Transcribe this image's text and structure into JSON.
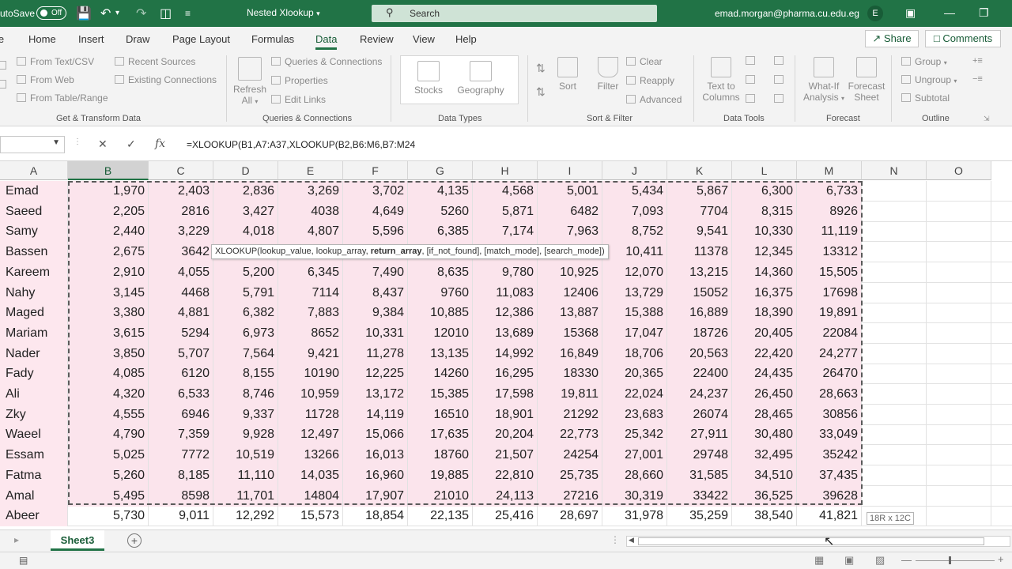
{
  "titlebar": {
    "autosave_label": "utoSave",
    "toggle_state": "Off",
    "doc_title": "Nested Xlookup",
    "search_placeholder": "Search",
    "account": "emad.morgan@pharma.cu.edu.eg",
    "avatar_initial": "E"
  },
  "tabs": [
    "le",
    "Home",
    "Insert",
    "Draw",
    "Page Layout",
    "Formulas",
    "Data",
    "Review",
    "View",
    "Help"
  ],
  "share_label": "Share",
  "comments_label": "Comments",
  "ribbon": {
    "get_transform": {
      "items": [
        "From Text/CSV",
        "From Web",
        "From Table/Range",
        "Recent Sources",
        "Existing Connections"
      ],
      "label": "Get & Transform Data"
    },
    "queries": {
      "refresh": "Refresh",
      "refresh_all": "All",
      "items": [
        "Queries & Connections",
        "Properties",
        "Edit Links"
      ],
      "label": "Queries & Connections"
    },
    "data_types": {
      "items": [
        "Stocks",
        "Geography"
      ],
      "label": "Data Types"
    },
    "sort_filter": {
      "sort": "Sort",
      "filter": "Filter",
      "items": [
        "Clear",
        "Reapply",
        "Advanced"
      ],
      "label": "Sort & Filter"
    },
    "data_tools": {
      "text_to": "Text to",
      "columns": "Columns",
      "label": "Data Tools"
    },
    "forecast": {
      "whatif": "What-If",
      "analysis": "Analysis",
      "forecast_line1": "Forecast",
      "forecast_line2": "Sheet",
      "label": "Forecast"
    },
    "outline": {
      "items": [
        "Group",
        "Ungroup",
        "Subtotal"
      ],
      "label": "Outline"
    }
  },
  "formula_bar": {
    "fx": "fx",
    "formula": "=XLOOKUP(B1,A7:A37,XLOOKUP(B2,B6:M6,B7:M24"
  },
  "columns": [
    "A",
    "B",
    "C",
    "D",
    "E",
    "F",
    "G",
    "H",
    "I",
    "J",
    "K",
    "L",
    "M",
    "N",
    "O"
  ],
  "rows": [
    [
      "Emad",
      "1,970",
      "2,403",
      "2,836",
      "3,269",
      "3,702",
      "4,135",
      "4,568",
      "5,001",
      "5,434",
      "5,867",
      "6,300",
      "6,733"
    ],
    [
      "Saeed",
      "2,205",
      "2816",
      "3,427",
      "4038",
      "4,649",
      "5260",
      "5,871",
      "6482",
      "7,093",
      "7704",
      "8,315",
      "8926"
    ],
    [
      "Samy",
      "2,440",
      "3,229",
      "4,018",
      "4,807",
      "5,596",
      "6,385",
      "7,174",
      "7,963",
      "8,752",
      "9,541",
      "10,330",
      "11,119"
    ],
    [
      "Bassen",
      "2,675",
      "3642",
      "",
      "",
      "",
      "",
      "",
      "",
      "10,411",
      "11378",
      "12,345",
      "13312"
    ],
    [
      "Kareem",
      "2,910",
      "4,055",
      "5,200",
      "6,345",
      "7,490",
      "8,635",
      "9,780",
      "10,925",
      "12,070",
      "13,215",
      "14,360",
      "15,505"
    ],
    [
      "Nahy",
      "3,145",
      "4468",
      "5,791",
      "7114",
      "8,437",
      "9760",
      "11,083",
      "12406",
      "13,729",
      "15052",
      "16,375",
      "17698"
    ],
    [
      "Maged",
      "3,380",
      "4,881",
      "6,382",
      "7,883",
      "9,384",
      "10,885",
      "12,386",
      "13,887",
      "15,388",
      "16,889",
      "18,390",
      "19,891"
    ],
    [
      "Mariam",
      "3,615",
      "5294",
      "6,973",
      "8652",
      "10,331",
      "12010",
      "13,689",
      "15368",
      "17,047",
      "18726",
      "20,405",
      "22084"
    ],
    [
      "Nader",
      "3,850",
      "5,707",
      "7,564",
      "9,421",
      "11,278",
      "13,135",
      "14,992",
      "16,849",
      "18,706",
      "20,563",
      "22,420",
      "24,277"
    ],
    [
      "Fady",
      "4,085",
      "6120",
      "8,155",
      "10190",
      "12,225",
      "14260",
      "16,295",
      "18330",
      "20,365",
      "22400",
      "24,435",
      "26470"
    ],
    [
      "Ali",
      "4,320",
      "6,533",
      "8,746",
      "10,959",
      "13,172",
      "15,385",
      "17,598",
      "19,811",
      "22,024",
      "24,237",
      "26,450",
      "28,663"
    ],
    [
      "Zky",
      "4,555",
      "6946",
      "9,337",
      "11728",
      "14,119",
      "16510",
      "18,901",
      "21292",
      "23,683",
      "26074",
      "28,465",
      "30856"
    ],
    [
      "Waeel",
      "4,790",
      "7,359",
      "9,928",
      "12,497",
      "15,066",
      "17,635",
      "20,204",
      "22,773",
      "25,342",
      "27,911",
      "30,480",
      "33,049"
    ],
    [
      "Essam",
      "5,025",
      "7772",
      "10,519",
      "13266",
      "16,013",
      "18760",
      "21,507",
      "24254",
      "27,001",
      "29748",
      "32,495",
      "35242"
    ],
    [
      "Fatma",
      "5,260",
      "8,185",
      "11,110",
      "14,035",
      "16,960",
      "19,885",
      "22,810",
      "25,735",
      "28,660",
      "31,585",
      "34,510",
      "37,435"
    ],
    [
      "Amal",
      "5,495",
      "8598",
      "11,701",
      "14804",
      "17,907",
      "21010",
      "24,113",
      "27216",
      "30,319",
      "33422",
      "36,525",
      "39628"
    ],
    [
      "Abeer",
      "5,730",
      "9,011",
      "12,292",
      "15,573",
      "18,854",
      "22,135",
      "25,416",
      "28,697",
      "31,978",
      "35,259",
      "38,540",
      "41,821"
    ]
  ],
  "tooltip": {
    "prefix": "XLOOKUP(lookup_value, lookup_array, ",
    "bold": "return_array",
    "suffix": ", [if_not_found], [match_mode], [search_mode])"
  },
  "size_tip": "18R x 12C",
  "sheet_tab": "Sheet3",
  "add_sheet": "+"
}
